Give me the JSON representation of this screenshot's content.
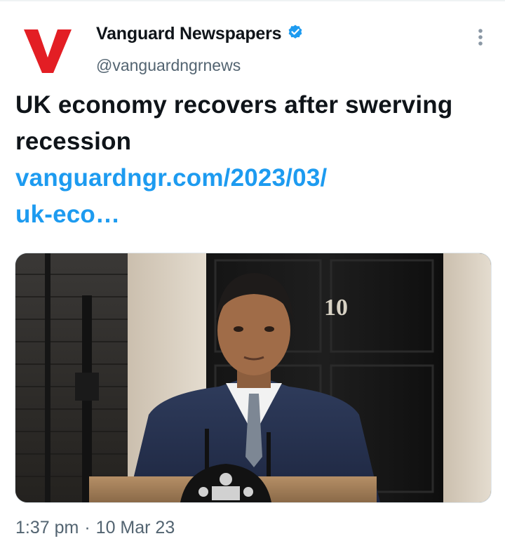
{
  "tweet": {
    "author": {
      "display_name": "Vanguard Newspapers",
      "handle": "@vanguardngrnews",
      "verified": true,
      "avatar_letter": "V",
      "avatar_color": "#e31e24"
    },
    "text": "UK economy recovers after swerving recession",
    "link_text": "vanguardngr.com/2023/03/\nuk-eco…",
    "media": {
      "door_number": "10",
      "description_icon": "photo"
    },
    "time": "1:37 pm",
    "separator": "·",
    "date": "10 Mar 23"
  },
  "colors": {
    "accent": "#1d9bf0",
    "verified_badge": "#1d9bf0",
    "secondary_text": "#536471"
  }
}
